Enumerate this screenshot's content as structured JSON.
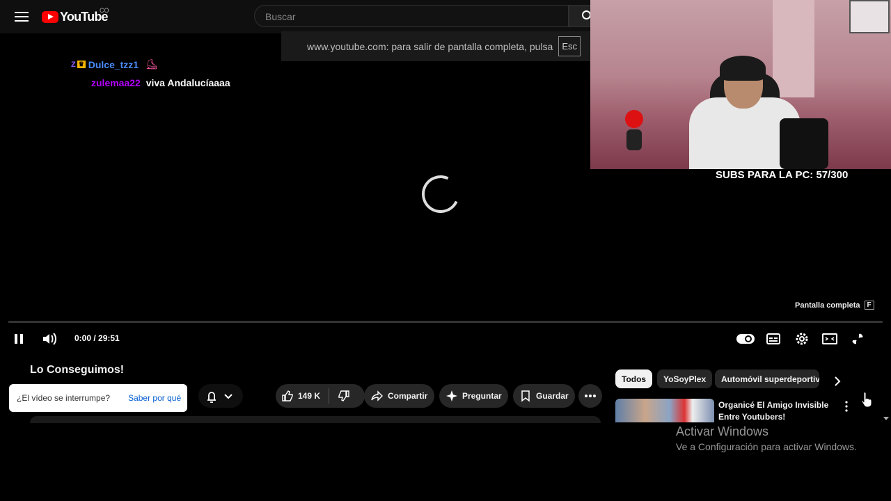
{
  "header": {
    "logo_text": "YouTube",
    "country_code": "CO",
    "search_placeholder": "Buscar"
  },
  "fullscreen_notice": {
    "message": "www.youtube.com: para salir de pantalla completa, pulsa",
    "key": "Esc"
  },
  "chat": [
    {
      "user": "Dulce_tzz1"
    },
    {
      "user": "zulemaa22",
      "message": "viva Andalucíaaaa"
    }
  ],
  "stream_overlay": {
    "subs_goal": "SUBS PARA LA PC: 57/300"
  },
  "player": {
    "time": "0:00 / 29:51",
    "fullscreen_tooltip": "Pantalla completa",
    "fullscreen_key": "F",
    "progress_fraction": 0
  },
  "video": {
    "title": "Lo Conseguimos!",
    "interrupt_question": "¿El vídeo se interrumpe?",
    "interrupt_link": "Saber por qué",
    "likes": "149 K",
    "share_label": "Compartir",
    "ask_label": "Preguntar",
    "save_label": "Guardar"
  },
  "chips": [
    "Todos",
    "YoSoyPlex",
    "Automóvil superdeportivo"
  ],
  "recommendation": {
    "title": "Organicé El Amigo Invisible Entre Youtubers!"
  },
  "windows_watermark": {
    "title": "Activar Windows",
    "subtitle": "Ve a Configuración para activar Windows."
  },
  "colors": {
    "youtube_red": "#ff0000",
    "link_blue": "#065fd4",
    "chat_user1": "#4a8cff",
    "chat_user2": "#b400ff"
  }
}
